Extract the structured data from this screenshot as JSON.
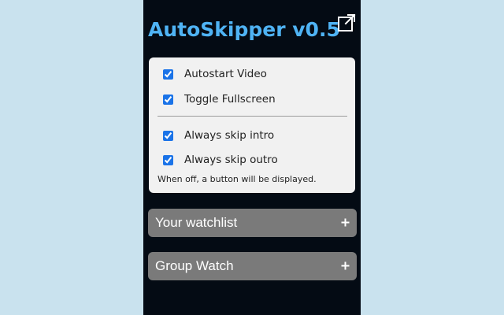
{
  "app": {
    "title": "AutoSkipper v0.5",
    "accent_color": "#4fb3f4",
    "background_color": "#040b14",
    "open_icon": "external-link-icon"
  },
  "settings": {
    "options_top": [
      {
        "label": "Autostart Video",
        "checked": true
      },
      {
        "label": "Toggle Fullscreen",
        "checked": true
      }
    ],
    "options_bottom": [
      {
        "label": "Always skip intro",
        "checked": true
      },
      {
        "label": "Always skip outro",
        "checked": true
      }
    ],
    "note": "When off, a button will be displayed."
  },
  "sections": [
    {
      "label": "Your watchlist",
      "icon": "plus-icon"
    },
    {
      "label": "Group Watch",
      "icon": "plus-icon"
    }
  ]
}
